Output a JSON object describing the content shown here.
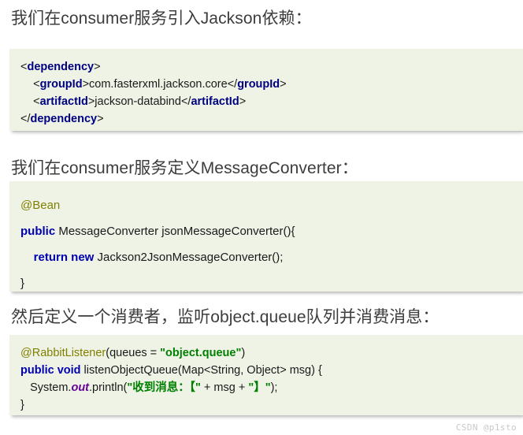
{
  "document": {
    "background_color": "#ffffff",
    "watermark": "CSDN @p1sto"
  },
  "sections": [
    {
      "heading": "我们在consumer服务引入Jackson依赖：",
      "code_language": "xml",
      "code_background": "#eef3e6"
    },
    {
      "heading": "我们在consumer服务定义MessageConverter：",
      "code_language": "java",
      "code_background": "#eef3e6"
    },
    {
      "heading": "然后定义一个消费者，监听object.queue队列并消费消息：",
      "code_language": "java",
      "code_background": "#eef3e6"
    }
  ],
  "code_block_1": {
    "line_1": {
      "t1": "<",
      "t2": "dependency",
      "t3": ">"
    },
    "line_2": {
      "t1": "    <",
      "t2": "groupId",
      "t3": ">com.fasterxml.jackson.core</",
      "t4": "groupId",
      "t5": ">"
    },
    "line_3": {
      "t1": "    <",
      "t2": "artifactId",
      "t3": ">jackson-databind</",
      "t4": "artifactId",
      "t5": ">"
    },
    "line_4": {
      "t1": "</",
      "t2": "dependency",
      "t3": ">"
    }
  },
  "code_block_2": {
    "line_1": {
      "t1": "@Bean"
    },
    "line_2": {
      "t1": "public",
      "t2": " MessageConverter jsonMessageConverter(){"
    },
    "line_3": {
      "t1": "    ",
      "t2": "return new",
      "t3": " Jackson2JsonMessageConverter();"
    },
    "line_4": {
      "t1": "}"
    }
  },
  "code_block_3": {
    "line_1": {
      "t1": "@RabbitListener",
      "t2": "(queues = ",
      "t3": "\"object.queue\"",
      "t4": ")"
    },
    "line_2": {
      "t1": "public void",
      "t2": " listenObjectQueue(Map<String, Object> msg) {"
    },
    "line_3": {
      "t1": "   System.",
      "t2": "out",
      "t3": ".println(",
      "t4": "\"收到消息：【\"",
      "t5": " + msg + ",
      "t6": "\"】\"",
      "t7": ");"
    },
    "line_4": {
      "t1": "}"
    }
  },
  "colors": {
    "code_bg": "#eef3e6",
    "xml_tag": "#000080",
    "java_keyword": "#0000b0",
    "annotation": "#808000",
    "string": "#008000",
    "static_field": "#660099",
    "heading_text": "#3d3d3d",
    "watermark_text": "#c9c9c9"
  }
}
